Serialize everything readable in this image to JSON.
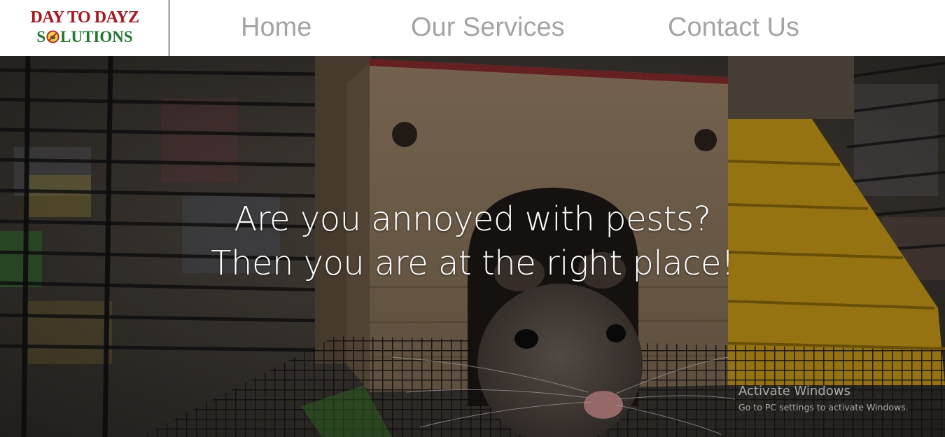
{
  "brand": {
    "line1": "DAY TO DAYZ",
    "line2_before": "S",
    "line2_after": "LUTIONS",
    "colors": {
      "line1": "#b31217",
      "line2": "#1f7a2f"
    },
    "seal_icon": "pest-control-seal-icon"
  },
  "nav": {
    "items": [
      {
        "label": "Home"
      },
      {
        "label": "Our Services"
      },
      {
        "label": "Contact Us"
      }
    ],
    "color": "#a4a4a4"
  },
  "hero": {
    "headline_line1": "Are you annoyed with pests?",
    "headline_line2": "Then you are at the right place!",
    "image": "rat-peeking-out-of-wooden-house-in-cage"
  },
  "watermark": {
    "title": "Activate Windows",
    "subtitle": "Go to PC settings to activate Windows."
  }
}
